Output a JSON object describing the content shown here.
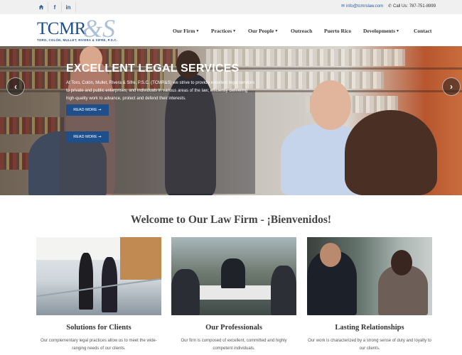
{
  "topbar": {
    "icons": [
      "home-icon",
      "facebook-icon",
      "linkedin-icon"
    ],
    "email": "info@tcmrslaw.com",
    "phone": "Call Us: 787-751-8999"
  },
  "logo": {
    "main": "TCMR",
    "amp": "&S",
    "subtitle": "TORO, COLÓN, MULLET, RIVERA & SIFRE, P.S.C."
  },
  "nav": {
    "items": [
      {
        "label": "Our Firm",
        "dropdown": true
      },
      {
        "label": "Practices",
        "dropdown": true
      },
      {
        "label": "Our People",
        "dropdown": true
      },
      {
        "label": "Outreach",
        "dropdown": false
      },
      {
        "label": "Puerto Rico",
        "dropdown": false
      },
      {
        "label": "Developments",
        "dropdown": true
      },
      {
        "label": "Contact",
        "dropdown": false
      }
    ]
  },
  "hero": {
    "title": "EXCELLENT LEGAL SERVICES",
    "text": "At Toro, Colón, Mullet, Rivera & Sifre, P.S.C. (TCMR&S) we strive to provide excellent legal services to private and public enterprises, and individuals in various areas of the law; efficiently delivering high-quality work to advance, protect and defend their interests.",
    "button_label": "READ MORE ➞",
    "button_label_2": "READ MORE ➞"
  },
  "welcome": {
    "heading": "Welcome to Our Law Firm - ¡Bienvenidos!"
  },
  "cards": [
    {
      "title": "Solutions for Clients",
      "text": "Our complementary legal practices allow us to meet the wide-ranging needs of our clients."
    },
    {
      "title": "Our Professionals",
      "text": "Our firm is composed of excellent, committed and highly competent individuals."
    },
    {
      "title": "Lasting Relationships",
      "text": "Our work is characterized by a strong sense of duty and loyalty to our clients."
    }
  ],
  "colors": {
    "brand_blue": "#1f4f8b",
    "topbar_bg": "#f0f0f0"
  }
}
